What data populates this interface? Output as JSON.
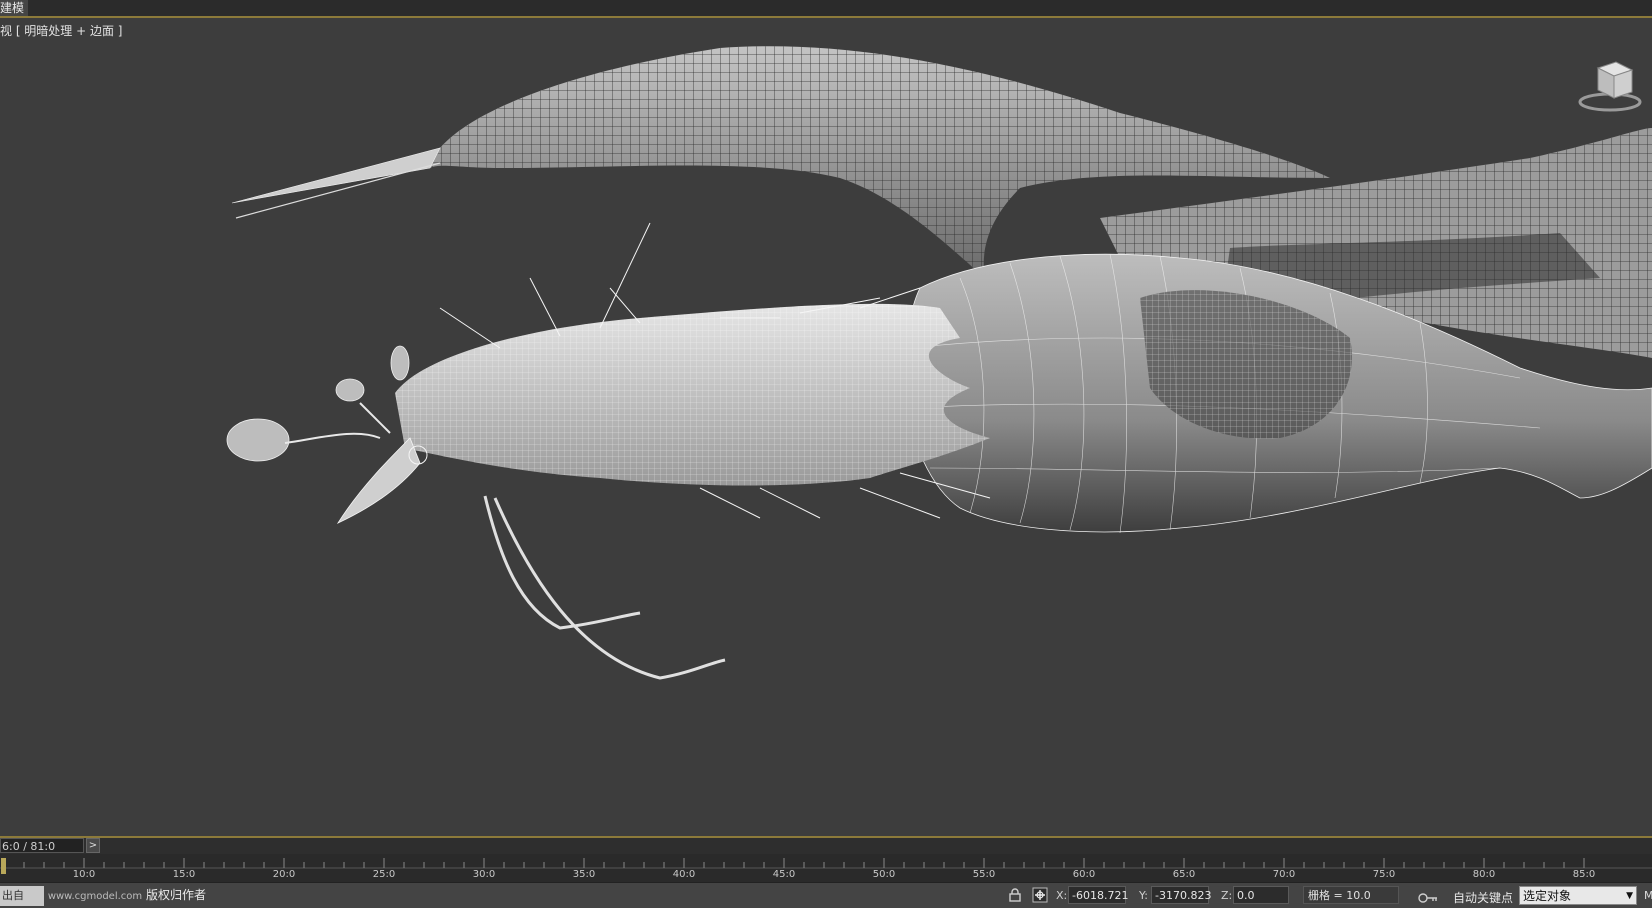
{
  "top_tab": "建模",
  "viewport": {
    "label": "视 [ 明暗处理 + 边面 ]"
  },
  "timeline": {
    "frame_counter": "6:0 / 81:0",
    "next_button": ">",
    "ticks": [
      "10:0",
      "15:0",
      "20:0",
      "25:0",
      "30:0",
      "35:0",
      "40:0",
      "45:0",
      "50:0",
      "55:0",
      "60:0",
      "65:0",
      "70:0",
      "75:0",
      "80:0",
      "85:0"
    ]
  },
  "status": {
    "left_mark": "出自",
    "left_site": "www.cgmodel.com",
    "left_text": "版权归作者",
    "x_label": "X:",
    "x_value": "-6018.721",
    "y_label": "Y:",
    "y_value": "-3170.823",
    "z_label": "Z:",
    "z_value": "0.0",
    "grid": "栅格 = 10.0",
    "autokey_label": "自动关键点",
    "selection_mode": "选定对象",
    "right_edge": "M"
  },
  "colors": {
    "accent": "#8c7a3a",
    "viewport_bg": "#3d3d3d",
    "wire": "#f2f2f2"
  }
}
